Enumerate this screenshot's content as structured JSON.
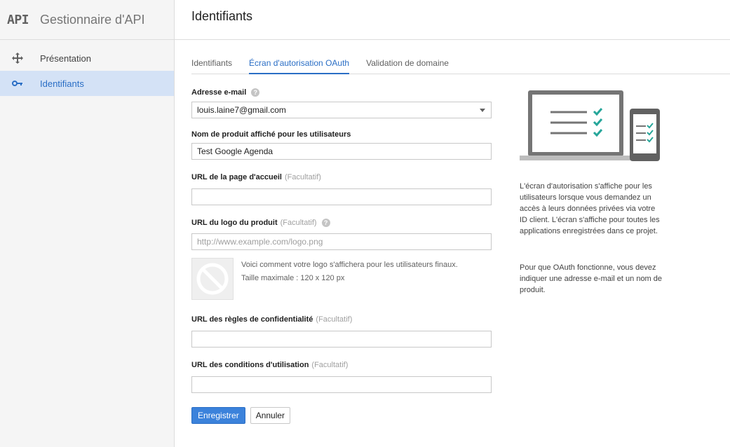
{
  "sidebar": {
    "logo": "API",
    "title": "Gestionnaire d'API",
    "items": [
      {
        "label": "Présentation",
        "icon": "move-icon",
        "active": false
      },
      {
        "label": "Identifiants",
        "icon": "key-icon",
        "active": true
      }
    ]
  },
  "header": {
    "title": "Identifiants"
  },
  "tabs": [
    {
      "label": "Identifiants",
      "active": false
    },
    {
      "label": "Écran d'autorisation OAuth",
      "active": true
    },
    {
      "label": "Validation de domaine",
      "active": false
    }
  ],
  "form": {
    "email": {
      "label": "Adresse e-mail",
      "value": "louis.laine7@gmail.com",
      "help": "?"
    },
    "product_name": {
      "label": "Nom de produit affiché pour les utilisateurs",
      "value": "Test Google Agenda"
    },
    "homepage_url": {
      "label": "URL de la page d'accueil",
      "optional": "(Facultatif)",
      "value": ""
    },
    "logo_url": {
      "label": "URL du logo du produit",
      "optional": "(Facultatif)",
      "placeholder": "http://www.example.com/logo.png",
      "help": "?"
    },
    "logo_preview": {
      "line1": "Voici comment votre logo s'affichera pour les utilisateurs finaux.",
      "line2": "Taille maximale : 120 x 120 px"
    },
    "privacy_url": {
      "label": "URL des règles de confidentialité",
      "optional": "(Facultatif)",
      "value": ""
    },
    "terms_url": {
      "label": "URL des conditions d'utilisation",
      "optional": "(Facultatif)",
      "value": ""
    },
    "save_label": "Enregistrer",
    "cancel_label": "Annuler"
  },
  "info": {
    "paragraph1": "L'écran d'autorisation s'affiche pour les utilisateurs lorsque vous demandez un accès à leurs données privées via votre ID client. L'écran s'affiche pour toutes les applications enregistrées dans ce projet.",
    "paragraph2": "Pour que OAuth fonctionne, vous devez indiquer une adresse e-mail et un nom de produit."
  },
  "colors": {
    "accent": "#2a6ec5",
    "primary_button": "#3b82db",
    "check_green": "#26a69a",
    "device_gray": "#757575"
  }
}
